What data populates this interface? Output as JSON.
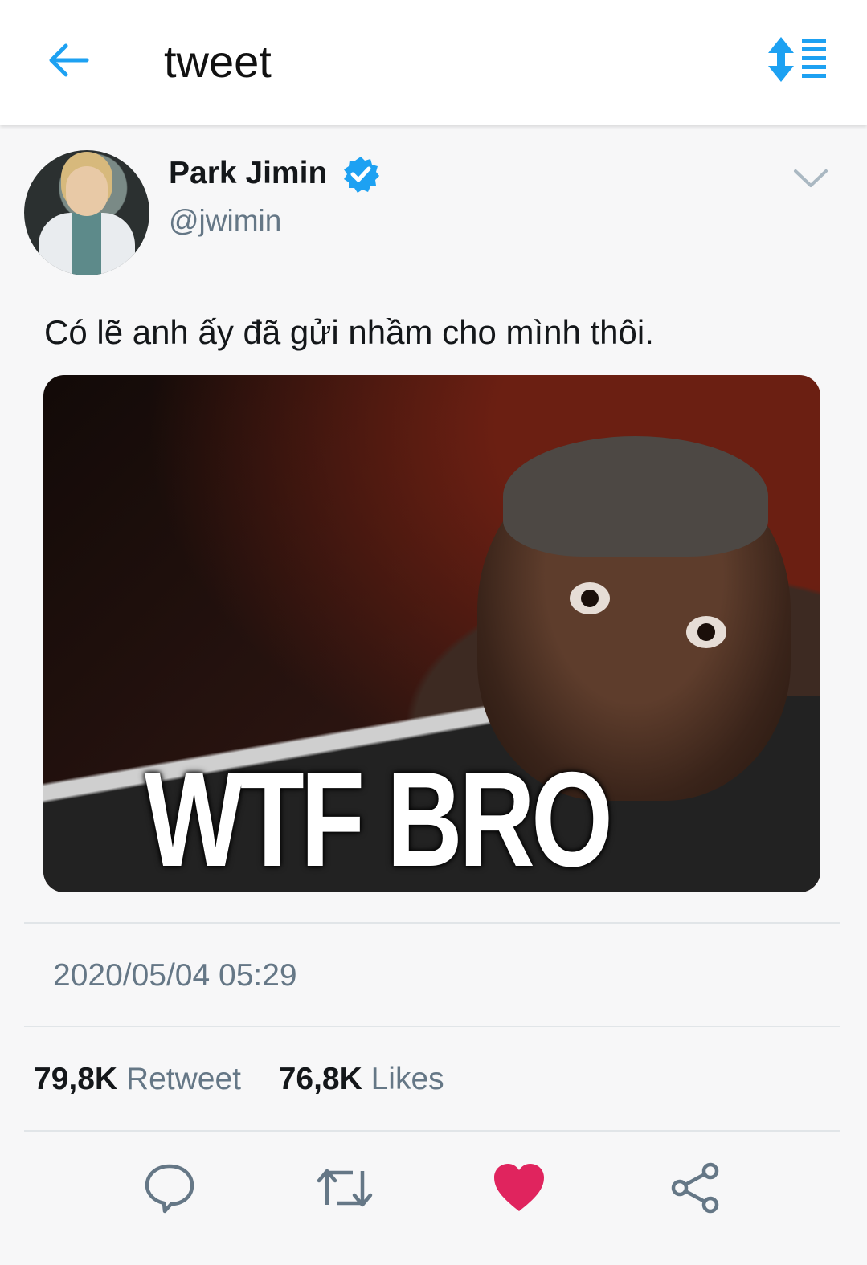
{
  "header": {
    "title": "tweet",
    "back_icon": "arrow-left-icon",
    "sort_icon": "sort-list-icon",
    "accent_color": "#1da1f2"
  },
  "tweet": {
    "author": {
      "name": "Park Jimin",
      "handle": "@jwimin",
      "verified": true
    },
    "text": "Có lẽ anh ấy đã gửi nhầm cho mình thôi.",
    "media": {
      "caption": "WTF BRO"
    },
    "timestamp": "2020/05/04 05:29",
    "stats": {
      "retweets_count": "79,8K",
      "retweets_label": "Retweet",
      "likes_count": "76,8K",
      "likes_label": "Likes"
    },
    "actions": {
      "reply_icon": "reply-icon",
      "retweet_icon": "retweet-icon",
      "like_icon": "heart-icon",
      "like_color": "#e0245e",
      "liked": true,
      "share_icon": "share-icon"
    }
  }
}
